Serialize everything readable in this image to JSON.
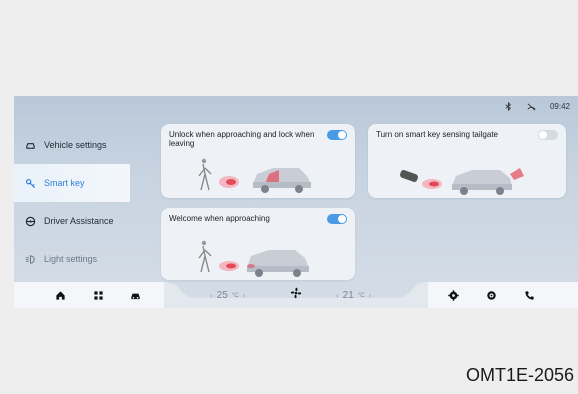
{
  "status": {
    "time": "09:42",
    "icons": [
      "bluetooth-icon",
      "signal-off-icon"
    ]
  },
  "sidebar": {
    "items": [
      {
        "label": "Vehicle settings",
        "icon": "car-icon",
        "active": false
      },
      {
        "label": "Smart key",
        "icon": "key-icon",
        "active": true
      },
      {
        "label": "Driver Assistance",
        "icon": "steering-wheel-icon",
        "active": false
      },
      {
        "label": "Light settings",
        "icon": "headlight-icon",
        "active": false
      }
    ]
  },
  "cards": {
    "unlock": {
      "title": "Unlock when approaching and lock when leaving",
      "enabled": true
    },
    "tailgate": {
      "title": "Turn on smart key sensing tailgate",
      "enabled": false
    },
    "welcome": {
      "title": "Welcome when approaching",
      "enabled": true
    }
  },
  "dock": {
    "left_icons": [
      "home-icon",
      "apps-grid-icon",
      "car-icon"
    ],
    "driver_temp": "25",
    "passenger_temp": "21",
    "temp_unit": "°C",
    "fan_icon": "fan-icon",
    "right_icons": [
      "settings-icon",
      "media-icon",
      "phone-icon"
    ]
  },
  "figure_code": "OMT1E-2056",
  "colors": {
    "accent": "#4a9be6",
    "active_text": "#2f7fd8",
    "screen_top": "#b9c8d9",
    "card_bg": "#eef2f6",
    "beam": "#e24a5a"
  }
}
